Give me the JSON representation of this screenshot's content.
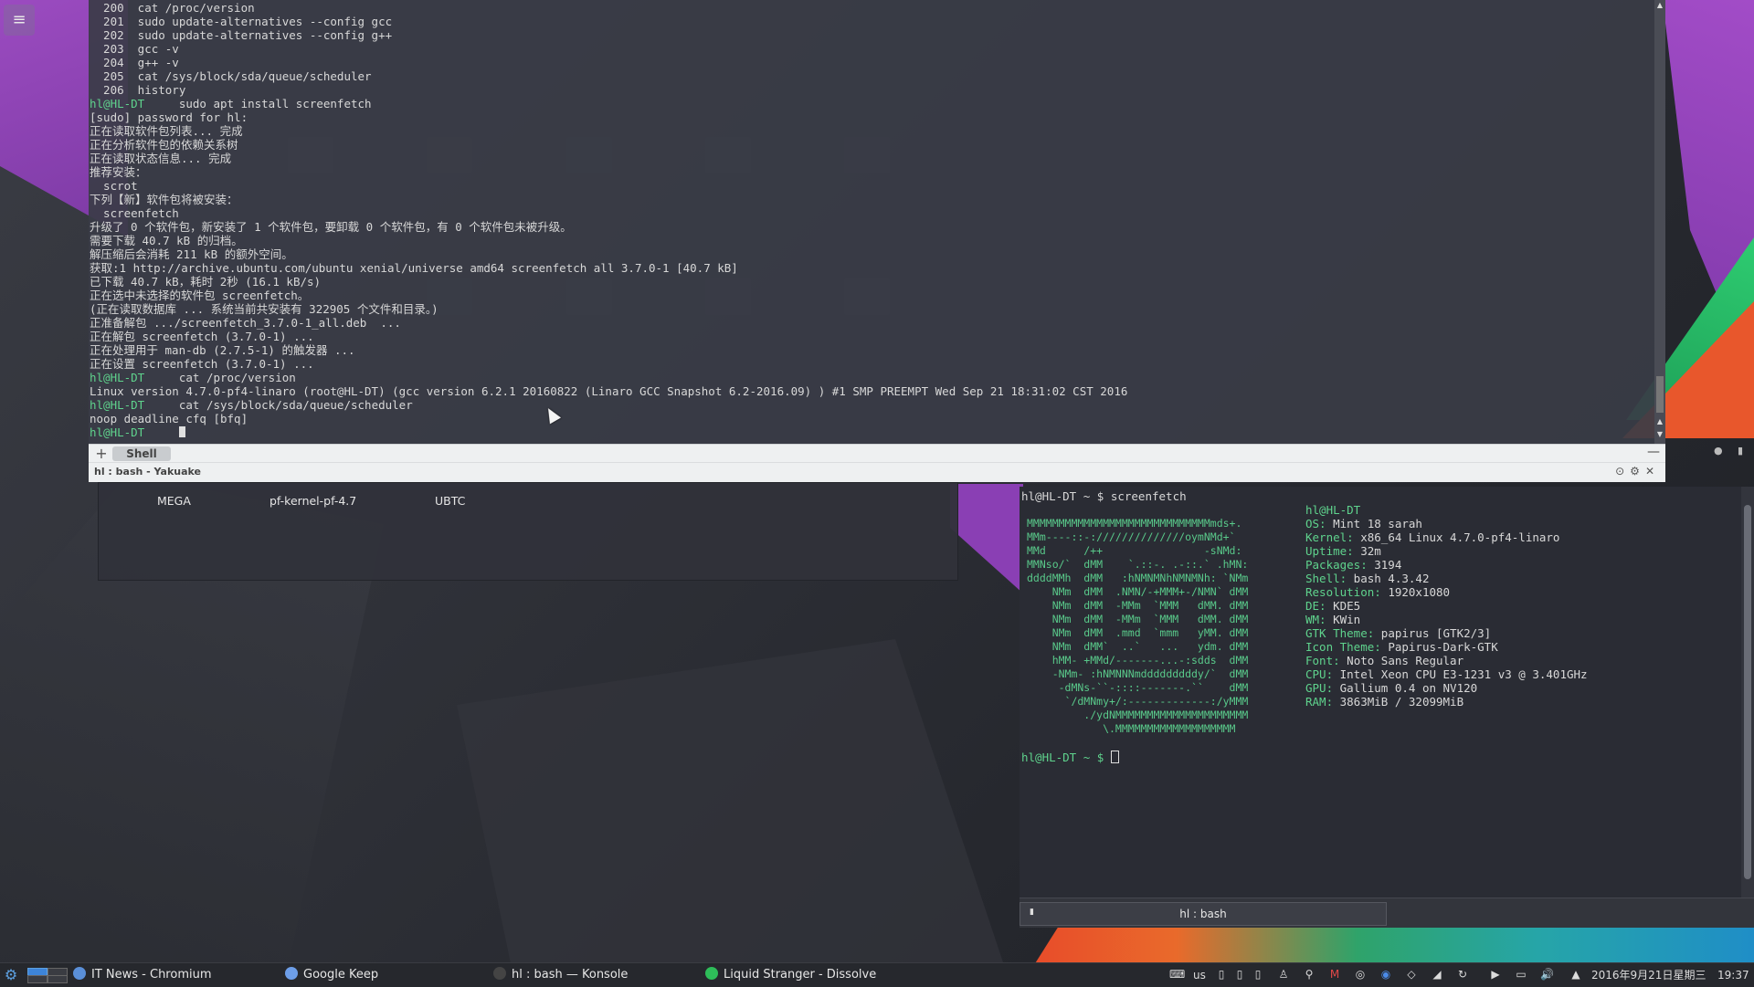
{
  "yakuake": {
    "lines": [
      {
        "p": "",
        "t": "  200  cat /proc/version"
      },
      {
        "p": "",
        "t": "  201  sudo update-alternatives --config gcc"
      },
      {
        "p": "",
        "t": "  202  sudo update-alternatives --config g++"
      },
      {
        "p": "",
        "t": "  203  gcc -v"
      },
      {
        "p": "",
        "t": "  204  g++ -v"
      },
      {
        "p": "",
        "t": "  205  cat /sys/block/sda/queue/scheduler"
      },
      {
        "p": "",
        "t": "  206  history"
      },
      {
        "p": "hl@HL-DT",
        "t": "     sudo apt install screenfetch"
      },
      {
        "p": "",
        "t": "[sudo] password for hl:"
      },
      {
        "p": "",
        "t": "正在读取软件包列表... 完成"
      },
      {
        "p": "",
        "t": "正在分析软件包的依赖关系树"
      },
      {
        "p": "",
        "t": "正在读取状态信息... 完成"
      },
      {
        "p": "",
        "t": "推荐安装："
      },
      {
        "p": "",
        "t": "  scrot"
      },
      {
        "p": "",
        "t": "下列【新】软件包将被安装："
      },
      {
        "p": "",
        "t": "  screenfetch"
      },
      {
        "p": "",
        "t": "升级了 0 个软件包，新安装了 1 个软件包，要卸载 0 个软件包，有 0 个软件包未被升级。"
      },
      {
        "p": "",
        "t": "需要下载 40.7 kB 的归档。"
      },
      {
        "p": "",
        "t": "解压缩后会消耗 211 kB 的额外空间。"
      },
      {
        "p": "",
        "t": "获取:1 http://archive.ubuntu.com/ubuntu xenial/universe amd64 screenfetch all 3.7.0-1 [40.7 kB]"
      },
      {
        "p": "",
        "t": "已下载 40.7 kB，耗时 2秒 (16.1 kB/s)"
      },
      {
        "p": "",
        "t": "正在选中未选择的软件包 screenfetch。"
      },
      {
        "p": "",
        "t": "(正在读取数据库 ... 系统当前共安装有 322905 个文件和目录。)"
      },
      {
        "p": "",
        "t": "正准备解包 .../screenfetch_3.7.0-1_all.deb  ..."
      },
      {
        "p": "",
        "t": "正在解包 screenfetch (3.7.0-1) ..."
      },
      {
        "p": "",
        "t": "正在处理用于 man-db (2.7.5-1) 的触发器 ..."
      },
      {
        "p": "",
        "t": "正在设置 screenfetch (3.7.0-1) ..."
      },
      {
        "p": "hl@HL-DT",
        "t": "     cat /proc/version"
      },
      {
        "p": "",
        "t": "Linux version 4.7.0-pf4-linaro (root@HL-DT) (gcc version 6.2.1 20160822 (Linaro GCC Snapshot 6.2-2016.09) ) #1 SMP PREEMPT Wed Sep 21 18:31:02 CST 2016"
      },
      {
        "p": "hl@HL-DT",
        "t": "     cat /sys/block/sda/queue/scheduler"
      },
      {
        "p": "",
        "t": "noop deadline cfq [bfq]"
      },
      {
        "p": "hl@HL-DT",
        "t": "     "
      }
    ],
    "tab_label": "Shell",
    "title": "hl : bash - Yakuake",
    "add_tab": "+",
    "minimize": "—"
  },
  "file_panel": {
    "items": [
      "MEGA",
      "pf-kernel-pf-4.7",
      "UBTC"
    ]
  },
  "konsole": {
    "command_line": "hl@HL-DT ~ $ screenfetch",
    "logo": [
      "MMMMMMMMMMMMMMMMMMMMMMMMMMMMMmds+.",
      "MMm----::-://////////////oymNMd+`",
      "MMd      /++                -sNMd:",
      "MMNso/`  dMM    `.::-. .-::.` .hMN:",
      "ddddMMh  dMM   :hNMNMNhNMNMNh: `NMm",
      "    NMm  dMM  .NMN/-+MMM+-/NMN` dMM",
      "    NMm  dMM  -MMm  `MMM   dMM. dMM",
      "    NMm  dMM  -MMm  `MMM   dMM. dMM",
      "    NMm  dMM  .mmd  `mmm   yMM. dMM",
      "    NMm  dMM`  ..`   ...   ydm. dMM",
      "    hMM- +MMd/-------...-:sdds  dMM",
      "    -NMm- :hNMNNNmdddddddddy/`  dMM",
      "     -dMNs-``-::::-------.``    dMM",
      "      `/dMNmy+/:-------------:/yMMM",
      "         ./ydNMMMMMMMMMMMMMMMMMMMMM",
      "            \\.MMMMMMMMMMMMMMMMMMM"
    ],
    "info_header": "hl@HL-DT",
    "info": [
      {
        "k": "OS:",
        "v": " Mint 18 sarah"
      },
      {
        "k": "Kernel:",
        "v": " x86_64 Linux 4.7.0-pf4-linaro"
      },
      {
        "k": "Uptime:",
        "v": " 32m"
      },
      {
        "k": "Packages:",
        "v": " 3194"
      },
      {
        "k": "Shell:",
        "v": " bash 4.3.42"
      },
      {
        "k": "Resolution:",
        "v": " 1920x1080"
      },
      {
        "k": "DE:",
        "v": " KDE5"
      },
      {
        "k": "WM:",
        "v": " KWin"
      },
      {
        "k": "GTK Theme:",
        "v": " papirus [GTK2/3]"
      },
      {
        "k": "Icon Theme:",
        "v": " Papirus-Dark-GTK"
      },
      {
        "k": "Font:",
        "v": " Noto Sans Regular"
      },
      {
        "k": "CPU:",
        "v": " Intel Xeon CPU E3-1231 v3 @ 3.401GHz"
      },
      {
        "k": "GPU:",
        "v": " Gallium 0.4 on NV120"
      },
      {
        "k": "RAM:",
        "v": " 3863MiB / 32099MiB"
      }
    ],
    "prompt": "hl@HL-DT ~ $",
    "tab_label": "hl : bash"
  },
  "taskbar": {
    "tasks": [
      {
        "label": "IT News - Chromium",
        "icon": "chromium-icon",
        "color": "#5a8fd8"
      },
      {
        "label": "Google Keep",
        "icon": "google-keep-icon",
        "color": "#6d9ee8"
      },
      {
        "label": "hl : bash — Konsole",
        "icon": "konsole-icon",
        "color": "#444"
      },
      {
        "label": "Liquid Stranger - Dissolve",
        "icon": "spotify-icon",
        "color": "#2ebd59"
      }
    ],
    "keyboard_layout": "us",
    "datetime": "2016年9月21日星期三",
    "time": "19:37"
  },
  "colors": {
    "prompt": "#5fd38d",
    "accent_green": "#2ecc71",
    "accent_purple": "#9b4bc0",
    "accent_orange": "#e8572c"
  }
}
